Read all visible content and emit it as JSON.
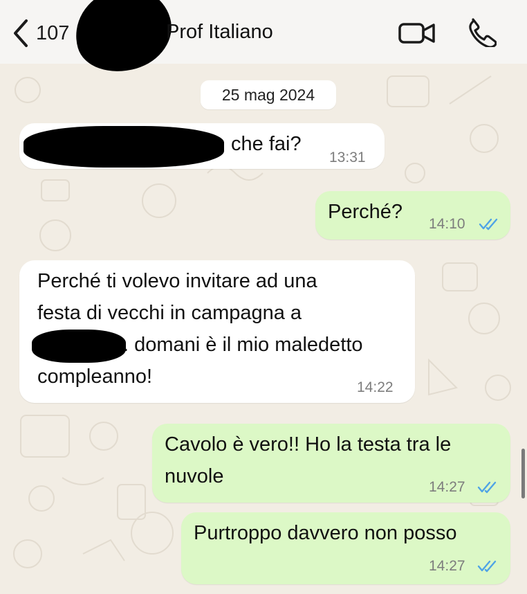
{
  "header": {
    "back_count": "107",
    "contact_name": "Prof Italiano",
    "icons": [
      "chevron-left-icon",
      "video-camera-icon",
      "phone-icon"
    ]
  },
  "date_separator": "25 mag 2024",
  "messages": [
    {
      "direction": "in",
      "text": "che fai?",
      "time": "13:31",
      "redacted_prefix": true
    },
    {
      "direction": "out",
      "text": "Perché?",
      "time": "14:10",
      "read": true
    },
    {
      "direction": "in",
      "lines": [
        "Perché ti volevo invitare ad una",
        "festa di vecchi in campagna a",
        ". domani è il mio maledetto",
        "compleanno!"
      ],
      "time": "14:22",
      "redacted_inline": true
    },
    {
      "direction": "out",
      "lines": [
        "Cavolo è vero!! Ho la testa tra le",
        "nuvole"
      ],
      "time": "14:27",
      "read": true
    },
    {
      "direction": "out",
      "text": "Purtroppo davvero non posso",
      "time": "14:27",
      "read": true
    }
  ],
  "colors": {
    "outgoing_bubble": "#dcf8c6",
    "incoming_bubble": "#ffffff",
    "read_ticks": "#4fa3e6",
    "wallpaper": "#f2ede4"
  }
}
